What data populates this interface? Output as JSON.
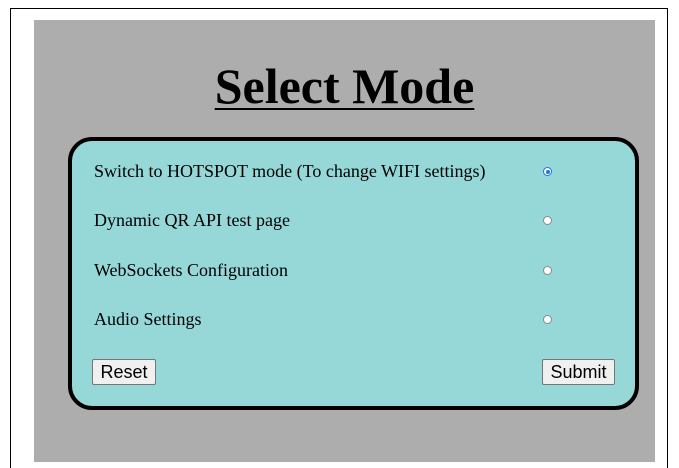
{
  "page": {
    "title": "Select Mode"
  },
  "form": {
    "options": [
      {
        "label": "Switch to HOTSPOT mode (To change WIFI settings)",
        "checked": true
      },
      {
        "label": "Dynamic QR API test page",
        "checked": false
      },
      {
        "label": "WebSockets Configuration",
        "checked": false
      },
      {
        "label": "Audio Settings",
        "checked": false
      }
    ],
    "reset_label": "Reset",
    "submit_label": "Submit"
  },
  "colors": {
    "panel_background": "#adadad",
    "form_background": "#96d7d8",
    "radio_accent": "#1a73e8"
  }
}
